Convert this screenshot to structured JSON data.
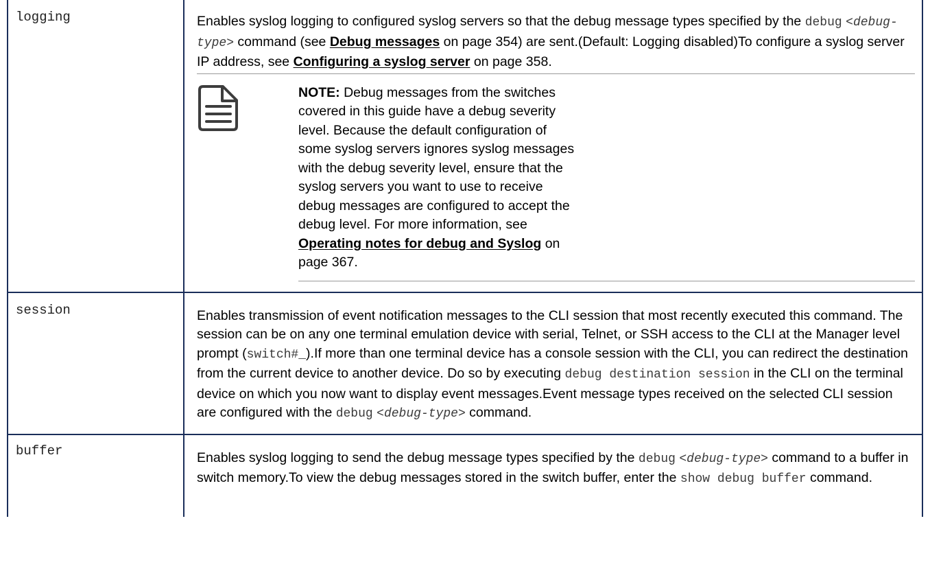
{
  "rows": [
    {
      "param": "logging",
      "desc": {
        "t1": "Enables syslog logging to configured syslog servers so that the debug message types specified by the ",
        "code1": "debug",
        "code1_arg": "<debug-type>",
        "t2": " command (see ",
        "link1": "Debug messages",
        "t3": " on page 354) are sent.(Default: Logging disabled)To configure a syslog server IP address, see ",
        "link2": "Configuring a syslog server",
        "t4": " on page 358."
      },
      "note": {
        "label": "NOTE:",
        "text": " Debug messages from the switches covered in this guide have a debug severity level. Because the default configuration of some syslog servers ignores syslog messages with the debug severity level, ensure that the syslog servers you want to use to receive debug messages are configured to accept the debug level. For more information, see ",
        "link": "Operating notes for debug and Syslog",
        "tail": " on page 367."
      }
    },
    {
      "param": "session",
      "desc": {
        "t1": "Enables transmission of event notification messages to the CLI session that most recently executed this command. The session can be on any one terminal emulation device with serial, Telnet, or SSH access to the CLI at the Manager level prompt (",
        "code1": "switch#_",
        "t2": ").If more than one terminal device has a console session with the CLI, you can redirect the destination from the current device to another device. Do so by executing ",
        "code2": "debug destination session",
        "t3": " in the CLI on the terminal device on which you now want to display event messages.Event message types received on the selected CLI session are configured with the ",
        "code3": "debug",
        "code3_arg": "<debug-type>",
        "t4": " command."
      }
    },
    {
      "param": "buffer",
      "desc": {
        "t1": "Enables syslog logging to send the debug message types specified by the ",
        "code1": "debug",
        "code1_arg": "<debug-type>",
        "t2": " command to a buffer in switch memory.To view the debug messages stored in the switch buffer, enter the ",
        "code2": "show debug buffer",
        "t3": " command."
      }
    }
  ],
  "icons": {
    "note": "note-document-icon"
  },
  "colors": {
    "border": "#1a2e5a",
    "rule": "#9a9a9a",
    "code": "#3a3a3a",
    "icon": "#3d3d3d"
  }
}
